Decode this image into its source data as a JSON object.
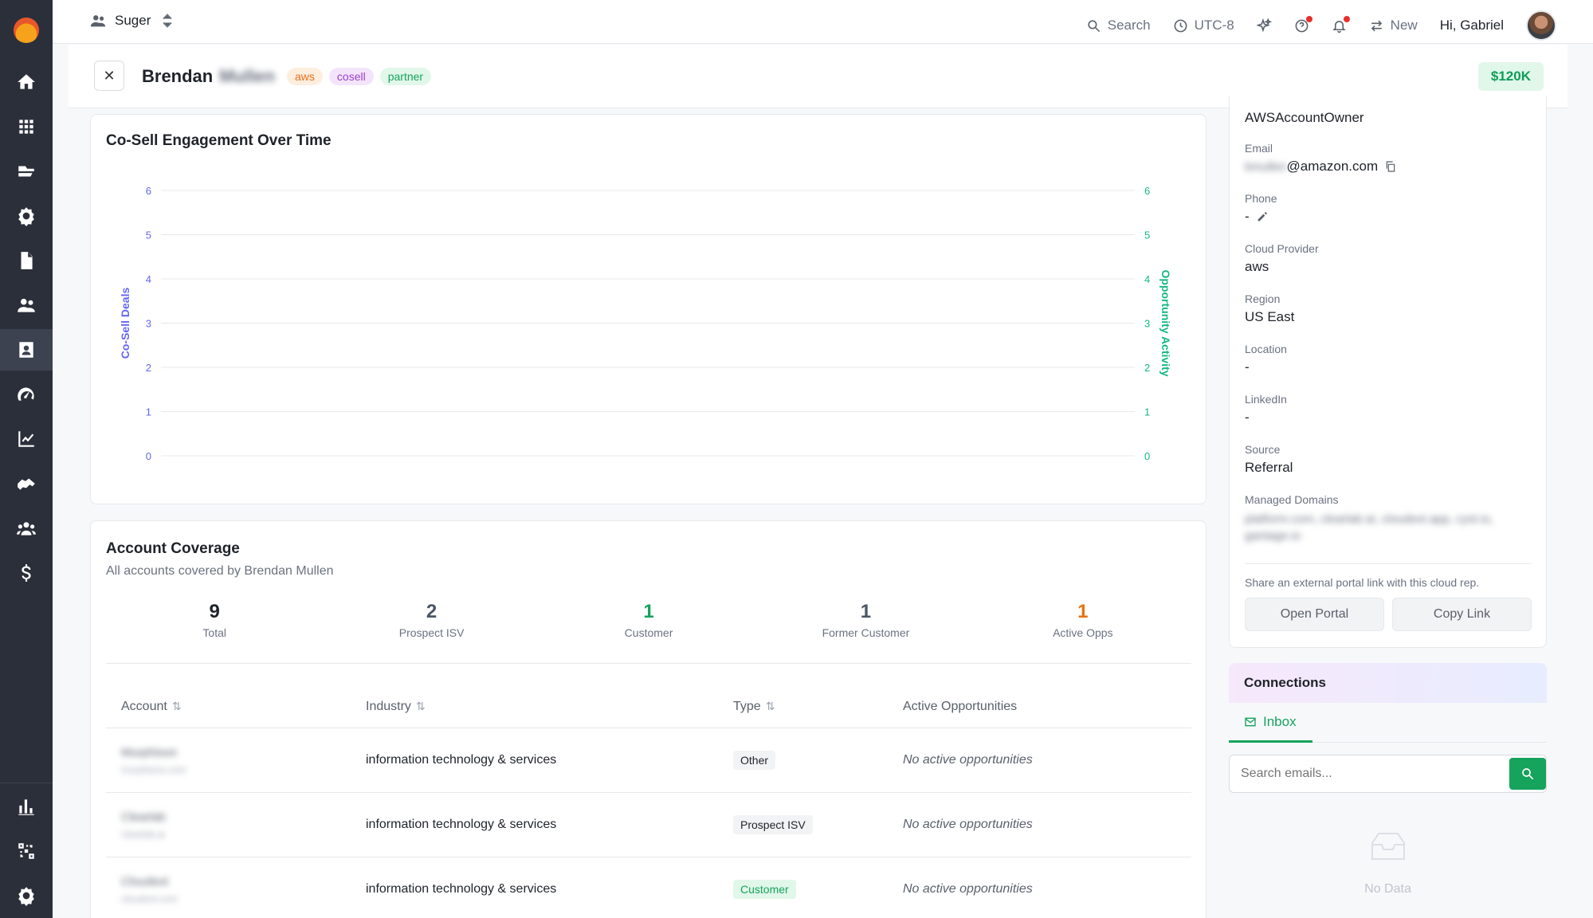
{
  "topbar": {
    "org_name": "Suger",
    "search_label": "Search",
    "timezone": "UTC-8",
    "new_label": "New",
    "greeting": "Hi, Gabriel"
  },
  "header": {
    "first_name": "Brendan",
    "last_name": "Mullen",
    "tags": [
      "aws",
      "cosell",
      "partner"
    ],
    "value": "$120K"
  },
  "engagement": {
    "title": "Co-Sell Engagement Over Time"
  },
  "chart_data": {
    "type": "line",
    "title": "Co-Sell Engagement Over Time",
    "ylabel_left": "Co-Sell Deals",
    "ylabel_right": "Opportunity Activity",
    "ylim_left": [
      0,
      6
    ],
    "ylim_right": [
      0,
      6
    ],
    "yticks": [
      0,
      1,
      2,
      3,
      4,
      5,
      6
    ],
    "series": [],
    "grid": true,
    "colors": {
      "left_axis": "#6366f1",
      "right_axis": "#10b981"
    }
  },
  "coverage": {
    "title": "Account Coverage",
    "subtitle": "All accounts covered by Brendan Mullen",
    "stats": [
      {
        "value": "9",
        "label": "Total",
        "color": "#1f2329"
      },
      {
        "value": "2",
        "label": "Prospect ISV",
        "color": "#4b5563"
      },
      {
        "value": "1",
        "label": "Customer",
        "color": "#16a35c"
      },
      {
        "value": "1",
        "label": "Former Customer",
        "color": "#4b5563"
      },
      {
        "value": "1",
        "label": "Active Opps",
        "color": "#e8720c"
      }
    ],
    "columns": [
      "Account",
      "Industry",
      "Type",
      "Active Opportunities"
    ],
    "rows": [
      {
        "account": "Murphison",
        "domain": "murphison.com",
        "industry": "information technology & services",
        "type": "Other",
        "opps": "No active opportunities"
      },
      {
        "account": "Clearlab",
        "domain": "clearlab.ai",
        "industry": "information technology & services",
        "type": "Prospect ISV",
        "opps": "No active opportunities"
      },
      {
        "account": "Cloudext",
        "domain": "cloudext.com",
        "industry": "information technology & services",
        "type": "Customer",
        "opps": "No active opportunities"
      }
    ]
  },
  "details": {
    "role": "AWSAccountOwner",
    "email_label": "Email",
    "email_user": "bmullen",
    "email_domain": "@amazon.com",
    "phone_label": "Phone",
    "phone_value": "-",
    "cloud_label": "Cloud Provider",
    "cloud_value": "aws",
    "region_label": "Region",
    "region_value": "US East",
    "location_label": "Location",
    "location_value": "-",
    "linkedin_label": "LinkedIn",
    "linkedin_value": "-",
    "source_label": "Source",
    "source_value": "Referral",
    "domains_label": "Managed Domains",
    "domains_line1": "platform.com, clearlab.ai, cloudext.app, cyst.io,",
    "domains_line2": "gantage.io",
    "share_text": "Share an external portal link with this cloud rep.",
    "open_portal": "Open Portal",
    "copy_link": "Copy Link"
  },
  "connections": {
    "title": "Connections",
    "inbox_tab": "Inbox",
    "search_placeholder": "Search emails...",
    "empty_text": "No Data"
  }
}
